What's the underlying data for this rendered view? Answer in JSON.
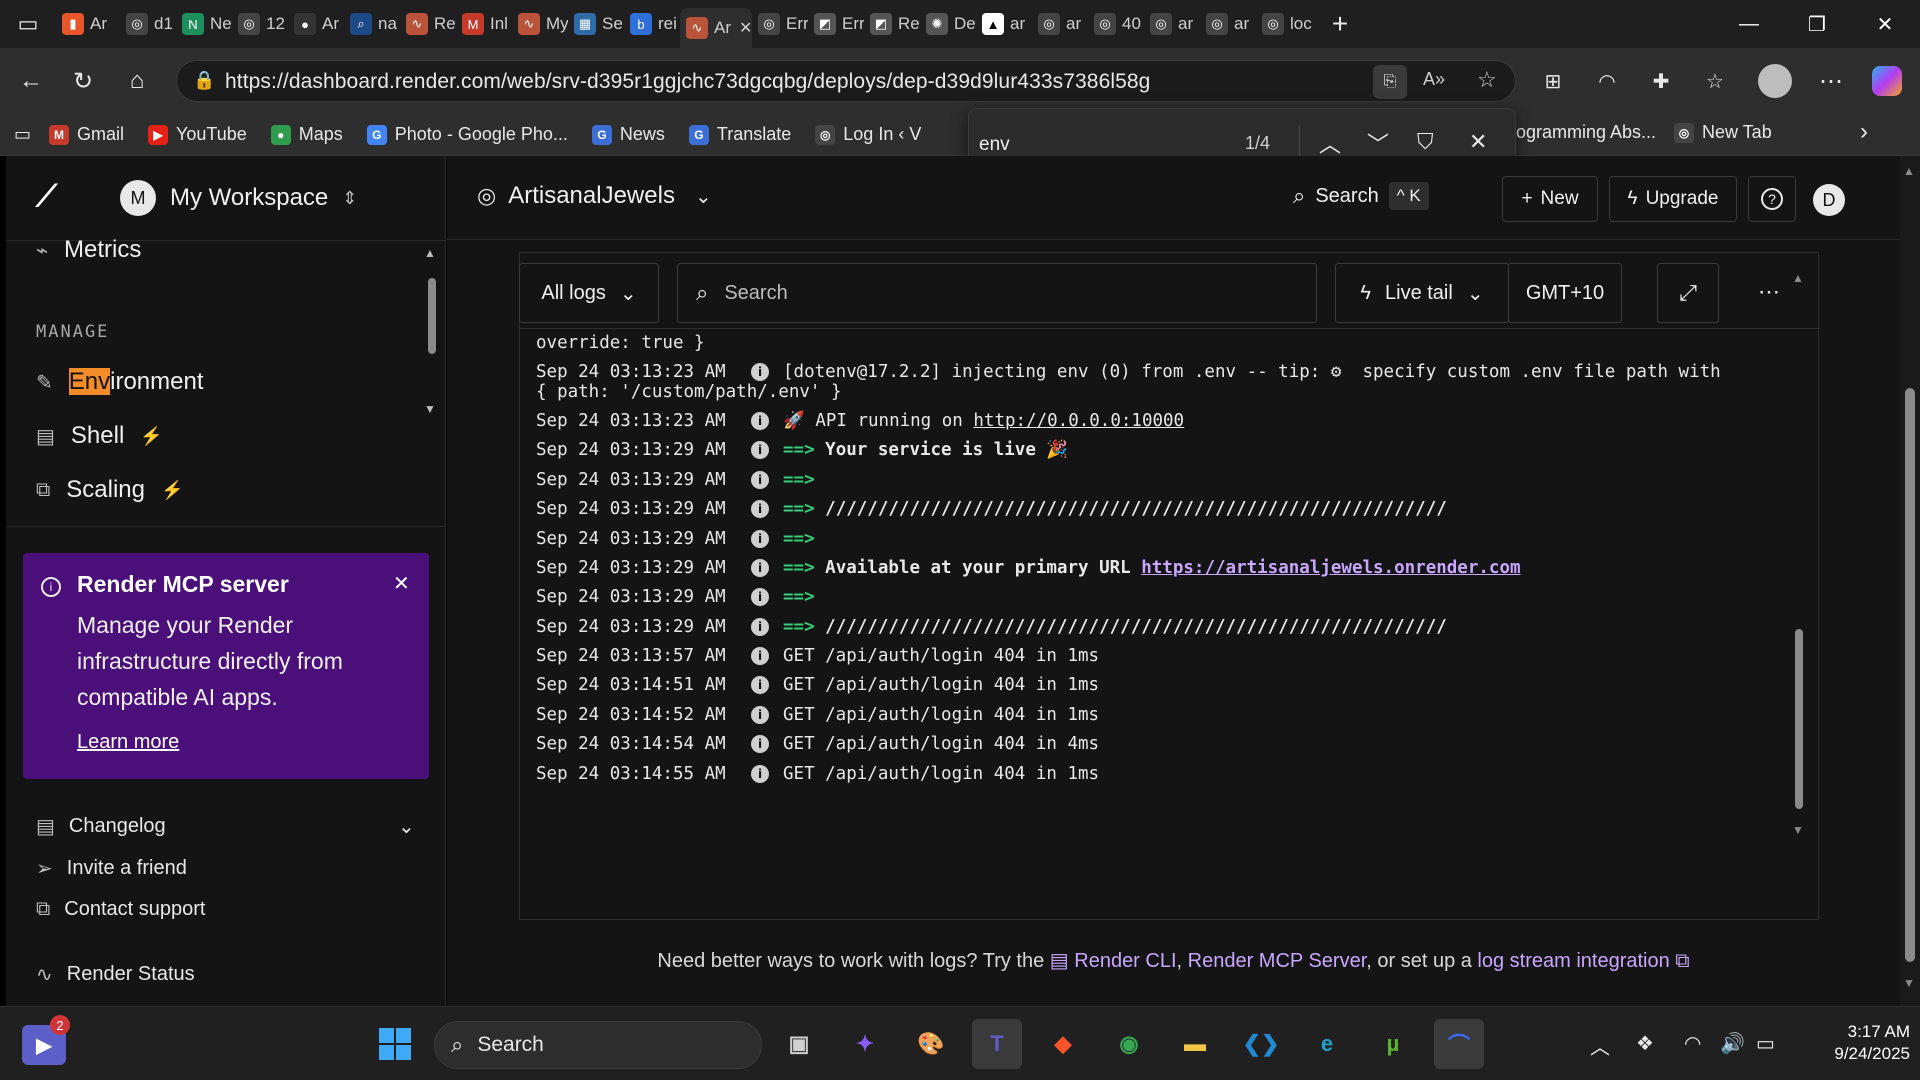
{
  "browser": {
    "tabs": [
      {
        "label": "Ar",
        "color": "#e8562a",
        "glyph": "▮"
      },
      {
        "label": "d1",
        "color": "#444",
        "glyph": "◎"
      },
      {
        "label": "Ne",
        "color": "#1d8f5c",
        "glyph": "N"
      },
      {
        "label": "12",
        "color": "#444",
        "glyph": "◎"
      },
      {
        "label": "Ar",
        "color": "#333",
        "glyph": "●"
      },
      {
        "label": "na",
        "color": "#1b4a86",
        "glyph": "⌕"
      },
      {
        "label": "Re",
        "color": "#b9543a",
        "glyph": "∿"
      },
      {
        "label": "Inl",
        "color": "#c53a2b",
        "glyph": "M"
      },
      {
        "label": "My",
        "color": "#b9543a",
        "glyph": "∿"
      },
      {
        "label": "Se",
        "color": "#2e6ca8",
        "glyph": "▦"
      },
      {
        "label": "rei",
        "color": "#2f6fd8",
        "glyph": "b"
      },
      {
        "label": "Ar",
        "color": "#b9543a",
        "glyph": "∿",
        "active": true
      },
      {
        "label": "Err",
        "color": "#444",
        "glyph": "◎"
      },
      {
        "label": "Err",
        "color": "#555",
        "glyph": "◩"
      },
      {
        "label": "Re",
        "color": "#555",
        "glyph": "◩"
      },
      {
        "label": "De",
        "color": "#555",
        "glyph": "✺"
      },
      {
        "label": "ar",
        "color": "#fff",
        "glyph": "▲"
      },
      {
        "label": "ar",
        "color": "#444",
        "glyph": "◎"
      },
      {
        "label": "40",
        "color": "#444",
        "glyph": "◎"
      },
      {
        "label": "ar",
        "color": "#444",
        "glyph": "◎"
      },
      {
        "label": "ar",
        "color": "#444",
        "glyph": "◎"
      },
      {
        "label": "loc",
        "color": "#444",
        "glyph": "◎"
      }
    ],
    "url": "https://dashboard.render.com/web/srv-d395r1ggjchc73dgcqbg/deploys/dep-d39d9lur433s7386l58g",
    "bookmarks": [
      {
        "label": "Gmail",
        "color": "#c53a2b",
        "glyph": "M"
      },
      {
        "label": "YouTube",
        "color": "#e62117",
        "glyph": "▶"
      },
      {
        "label": "Maps",
        "color": "#2e9b4d",
        "glyph": "●"
      },
      {
        "label": "Photo - Google Pho...",
        "color": "#4285f4",
        "glyph": "G"
      },
      {
        "label": "News",
        "color": "#3b6fd6",
        "glyph": "G"
      },
      {
        "label": "Translate",
        "color": "#3b6fd6",
        "glyph": "G"
      },
      {
        "label": "Log In ‹ V",
        "color": "#444",
        "glyph": "◎"
      }
    ],
    "bookmarks_right": [
      {
        "label": "ogramming Abs...",
        "color": "",
        "glyph": ""
      },
      {
        "label": "New Tab",
        "color": "#444",
        "glyph": "◎"
      }
    ],
    "find": {
      "query": "env",
      "count": "1/4"
    }
  },
  "sidebar": {
    "workspace_initial": "M",
    "workspace_name": "My Workspace",
    "metrics_label": "Metrics",
    "section_manage": "MANAGE",
    "environment_highlight": "Env",
    "environment_rest": "ironment",
    "shell_label": "Shell",
    "scaling_label": "Scaling",
    "promo": {
      "title": "Render MCP server",
      "body": "Manage your Render infrastructure directly from compatible AI apps.",
      "link": "Learn more"
    },
    "changelog": "Changelog",
    "invite": "Invite a friend",
    "support": "Contact support",
    "status": "Render Status"
  },
  "header": {
    "project": "ArtisanalJewels",
    "search": "Search",
    "shortcut": "^ K",
    "new_label": "New",
    "upgrade_label": "Upgrade",
    "user_initial": "D"
  },
  "logtools": {
    "filter": "All logs",
    "search_placeholder": "Search",
    "live_tail": "Live tail",
    "timezone": "GMT+10"
  },
  "logs": {
    "first_line": "override: true }",
    "rows": [
      {
        "ts": "Sep 24 03:13:23 AM",
        "parts": [
          {
            "t": "[dotenv@17.2.2] injecting env (0) from .env -- tip: ⚙  specify custom .env file path with"
          }
        ]
      },
      {
        "ts": "",
        "parts": [
          {
            "t": "{ path: '/custom/path/.env' }"
          }
        ]
      },
      {
        "ts": "Sep 24 03:13:23 AM",
        "parts": [
          {
            "t": "🚀 API running on "
          },
          {
            "t": "http://0.0.0.0:10000",
            "c": "link"
          }
        ]
      },
      {
        "ts": "Sep 24 03:13:29 AM",
        "parts": [
          {
            "t": "==> ",
            "c": "arrow"
          },
          {
            "t": "Your service is live 🎉",
            "c": "bold"
          }
        ]
      },
      {
        "ts": "Sep 24 03:13:29 AM",
        "parts": [
          {
            "t": "==>",
            "c": "arrow"
          }
        ]
      },
      {
        "ts": "Sep 24 03:13:29 AM",
        "parts": [
          {
            "t": "==> ",
            "c": "arrow"
          },
          {
            "t": "///////////////////////////////////////////////////////////",
            "c": "bold"
          }
        ]
      },
      {
        "ts": "Sep 24 03:13:29 AM",
        "parts": [
          {
            "t": "==>",
            "c": "arrow"
          }
        ]
      },
      {
        "ts": "Sep 24 03:13:29 AM",
        "parts": [
          {
            "t": "==> ",
            "c": "arrow"
          },
          {
            "t": "Available at your primary URL ",
            "c": "bold"
          },
          {
            "t": "https://artisanaljewels.onrender.com",
            "c": "bold link purple"
          }
        ]
      },
      {
        "ts": "Sep 24 03:13:29 AM",
        "parts": [
          {
            "t": "==>",
            "c": "arrow"
          }
        ]
      },
      {
        "ts": "Sep 24 03:13:29 AM",
        "parts": [
          {
            "t": "==> ",
            "c": "arrow"
          },
          {
            "t": "///////////////////////////////////////////////////////////",
            "c": "bold"
          }
        ]
      },
      {
        "ts": "Sep 24 03:13:57 AM",
        "parts": [
          {
            "t": "GET /api/auth/login 404 in 1ms"
          }
        ]
      },
      {
        "ts": "Sep 24 03:14:51 AM",
        "parts": [
          {
            "t": "GET /api/auth/login 404 in 1ms"
          }
        ]
      },
      {
        "ts": "Sep 24 03:14:52 AM",
        "parts": [
          {
            "t": "GET /api/auth/login 404 in 1ms"
          }
        ]
      },
      {
        "ts": "Sep 24 03:14:54 AM",
        "parts": [
          {
            "t": "GET /api/auth/login 404 in 4ms"
          }
        ]
      },
      {
        "ts": "Sep 24 03:14:55 AM",
        "parts": [
          {
            "t": "GET /api/auth/login 404 in 1ms"
          }
        ]
      }
    ]
  },
  "footnote": {
    "prefix": "Need better ways to work with logs? Try the ",
    "cli": "Render CLI",
    "sep": ", ",
    "mcp": "Render MCP Server",
    "mid": ", or set up a ",
    "stream": "log stream integration"
  },
  "taskbar": {
    "search": "Search",
    "badge": "2",
    "time": "3:17 AM",
    "date": "9/24/2025",
    "apps": [
      {
        "name": "taskview",
        "color": "#d0d0d0",
        "glyph": "▣"
      },
      {
        "name": "copilot",
        "color": "#8a5cf6",
        "glyph": "✦"
      },
      {
        "name": "paint",
        "color": "#3b9ae1",
        "glyph": "🎨"
      },
      {
        "name": "teams",
        "color": "#5b5fc7",
        "glyph": "T"
      },
      {
        "name": "brave",
        "color": "#fb542b",
        "glyph": "◆"
      },
      {
        "name": "chrome",
        "color": "#34a853",
        "glyph": "◉"
      },
      {
        "name": "explorer",
        "color": "#f4c542",
        "glyph": "▬"
      },
      {
        "name": "vscode",
        "color": "#1f8ad2",
        "glyph": "❮❯"
      },
      {
        "name": "edge",
        "color": "#1fa0c9",
        "glyph": "e"
      },
      {
        "name": "utorrent",
        "color": "#5cb531",
        "glyph": "µ"
      },
      {
        "name": "arc",
        "color": "#3d6cf2",
        "glyph": "⌒"
      }
    ]
  }
}
